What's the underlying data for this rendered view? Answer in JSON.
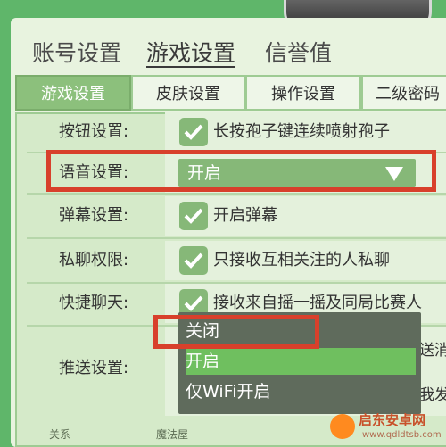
{
  "top_tabs": [
    {
      "label": "账号设置",
      "active": false
    },
    {
      "label": "游戏设置",
      "active": true
    },
    {
      "label": "信誉值",
      "active": false
    }
  ],
  "sub_tabs": [
    {
      "label": "游戏设置",
      "active": true
    },
    {
      "label": "皮肤设置",
      "active": false
    },
    {
      "label": "操作设置",
      "active": false
    },
    {
      "label": "二级密码",
      "active": false
    }
  ],
  "settings": {
    "button_settings": {
      "label": "按钮设置:",
      "checked": true,
      "text": "长按孢子键连续喷射孢子"
    },
    "voice_settings": {
      "label": "语音设置:",
      "value": "开启"
    },
    "barrage_settings": {
      "label": "弹幕设置:",
      "checked": true,
      "text": "开启弹幕"
    },
    "private_chat": {
      "label": "私聊权限:",
      "checked": true,
      "text": "只接收互相关注的人私聊"
    },
    "quick_chat": {
      "label": "快捷聊天:",
      "checked": true,
      "text": "接收来自摇一摇及同局比赛人"
    },
    "push_settings": {
      "label": "推送设置:",
      "text_1": "送消息",
      "text_2": "我发送"
    }
  },
  "voice_dropdown": {
    "options": [
      "关闭",
      "开启",
      "仅WiFi开启"
    ],
    "selected": "开启"
  },
  "bottom_nav": {
    "relations": "关系",
    "magic_house": "魔法屋"
  },
  "watermark": {
    "title": "启东安卓网",
    "url": "www.qdldtsb.com"
  },
  "colors": {
    "background": "#5fb66a",
    "accent": "#86b878",
    "highlight_frame": "#d8402b"
  }
}
